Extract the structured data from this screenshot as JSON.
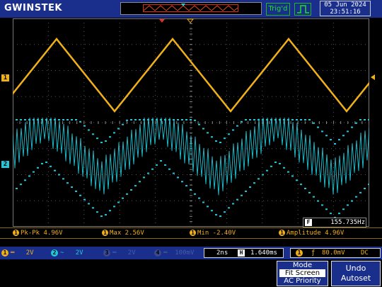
{
  "header": {
    "brand": "GWINSTEK",
    "trigger_status": "Trig'd",
    "trigger_icon": "rising-edge-icon",
    "date": "05 Jun 2024",
    "time": "23:51:16"
  },
  "markers": {
    "ch1": "1",
    "ch2": "2"
  },
  "waveforms": {
    "ch1": {
      "shape": "triangle",
      "color": "#f0b018",
      "cycles": 3
    },
    "ch2": {
      "shape": "triangle-modulated carrier",
      "color": "#22c8d8"
    }
  },
  "frequency": {
    "icon": "F",
    "value": "155.735Hz"
  },
  "measurements": [
    {
      "ch": "1",
      "text": "Pk-Pk 4.96V"
    },
    {
      "ch": "1",
      "text": "Max 2.56V"
    },
    {
      "ch": "1",
      "text": "Min -2.40V"
    },
    {
      "ch": "1",
      "text": "Amplitude 4.96V"
    }
  ],
  "channels": {
    "ch1": {
      "num": "1",
      "coupling": "═",
      "scale": "2V",
      "color": "#f0b018"
    },
    "ch2": {
      "num": "2",
      "coupling": "~",
      "scale": "2V",
      "color": "#22c8d8"
    },
    "ch3": {
      "num": "3",
      "coupling": "═",
      "scale": "2V",
      "color": "#3a4a8c"
    },
    "ch4": {
      "num": "4",
      "coupling": "═",
      "scale": "100mV",
      "color": "#3a4a8c"
    }
  },
  "horizontal": {
    "timebase": "2ns",
    "icon": "H",
    "position": "1.640ms"
  },
  "trigger": {
    "source": "1",
    "slope": "ƒ",
    "level": "80.0mV",
    "coupling": "DC"
  },
  "softkeys": {
    "mode": {
      "title": "Mode",
      "selected": "Fit Screen",
      "other": "AC Priority"
    },
    "undo": {
      "line1": "Undo",
      "line2": "Autoset"
    }
  }
}
